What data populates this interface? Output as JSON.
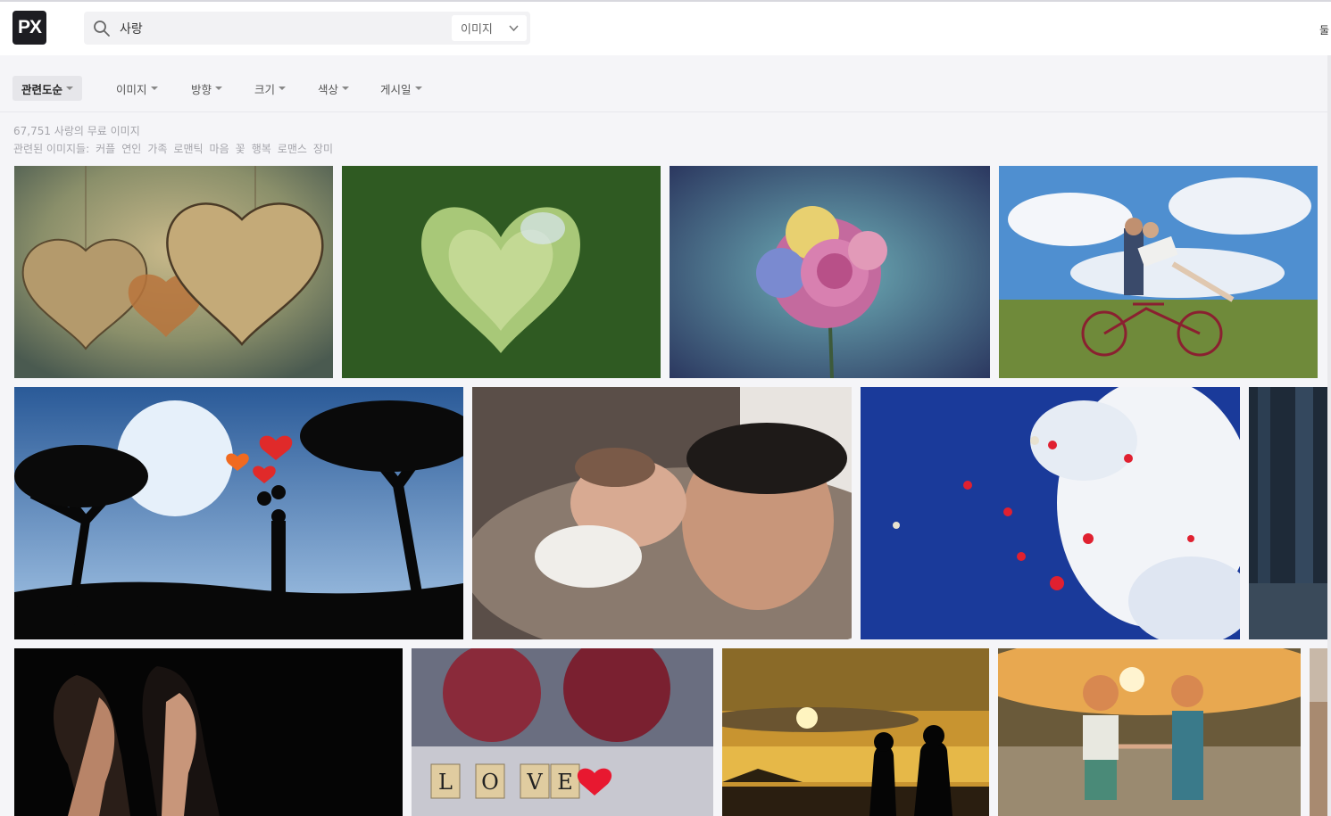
{
  "header": {
    "logo_text": "PX",
    "search": {
      "value": "사랑"
    },
    "type_select": {
      "selected": "이미지"
    },
    "edge_text": "둘"
  },
  "filters": [
    {
      "label": "관련도순"
    },
    {
      "label": "이미지"
    },
    {
      "label": "방향"
    },
    {
      "label": "크기"
    },
    {
      "label": "색상"
    },
    {
      "label": "게시일"
    }
  ],
  "results": {
    "count_text": "67,751 사랑의 무료 이미지",
    "related_label": "관련된 이미지들:",
    "related_tags": [
      "커플",
      "연인",
      "가족",
      "로맨틱",
      "마음",
      "꽃",
      "행복",
      "로맨스",
      "장미"
    ]
  },
  "photos": [
    {
      "subject": "wooden hearts",
      "label_text": ""
    },
    {
      "subject": "heart hedge",
      "label_text": ""
    },
    {
      "subject": "rainbow rose",
      "label_text": ""
    },
    {
      "subject": "couple on bicycle",
      "label_text": ""
    },
    {
      "subject": "couple silhouette under moon",
      "label_text": ""
    },
    {
      "subject": "father and sleeping baby",
      "label_text": ""
    },
    {
      "subject": "heart balloons in sky",
      "label_text": ""
    },
    {
      "subject": "dark forest",
      "label_text": ""
    },
    {
      "subject": "couple profiles in dark",
      "label_text": ""
    },
    {
      "subject": "love scrabble tiles",
      "tiles": [
        "L",
        "O",
        "V",
        "E"
      ]
    },
    {
      "subject": "couple at sunset lake",
      "label_text": ""
    },
    {
      "subject": "children holding hands",
      "label_text": ""
    },
    {
      "subject": "partial image",
      "label_text": ""
    }
  ],
  "colors": {
    "accent": "#1d1d22",
    "muted_text": "#a5a5ab",
    "page_bg": "#f5f5f8"
  }
}
